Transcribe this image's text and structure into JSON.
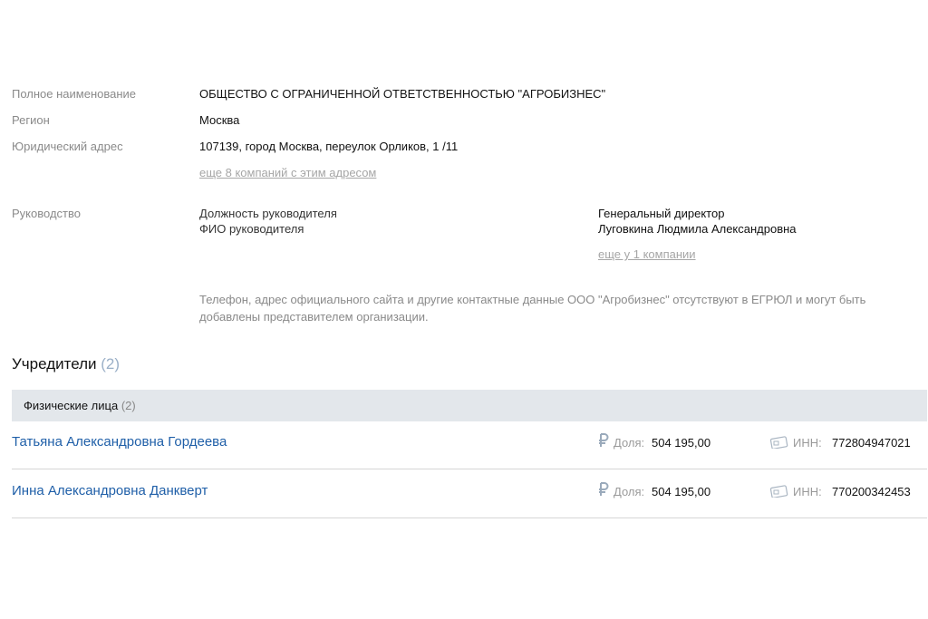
{
  "company": {
    "full_name_label": "Полное наименование",
    "full_name": "ОБЩЕСТВО С ОГРАНИЧЕННОЙ ОТВЕТСТВЕННОСТЬЮ \"АГРОБИЗНЕС\"",
    "region_label": "Регион",
    "region": "Москва",
    "address_label": "Юридический адрес",
    "address": "107139, город Москва, переулок Орликов, 1 /11",
    "address_more": "еще 8 компаний с этим адресом"
  },
  "management": {
    "label": "Руководство",
    "position_label": "Должность руководителя",
    "position": "Генеральный директор",
    "name_label": "ФИО руководителя",
    "name": "Луговкина Людмила Александровна",
    "more": "еще у 1 компании"
  },
  "contact_note": "Телефон, адрес официального сайта и другие контактные данные ООО \"Агробизнес\" отсутствуют в ЕГРЮЛ и могут быть добавлены представителем организации.",
  "founders": {
    "title": "Учредители",
    "count": "(2)",
    "group_label": "Физические лица",
    "group_count": "(2)",
    "share_label": "Доля:",
    "inn_label": "ИНН:",
    "icons": [
      "ruble-icon",
      "id-card-icon"
    ],
    "rows": [
      {
        "name": "Татьяна Александровна Гордеева",
        "share": "504 195,00",
        "inn": "772804947021"
      },
      {
        "name": "Инна Александровна Данкверт",
        "share": "504 195,00",
        "inn": "770200342453"
      }
    ]
  }
}
